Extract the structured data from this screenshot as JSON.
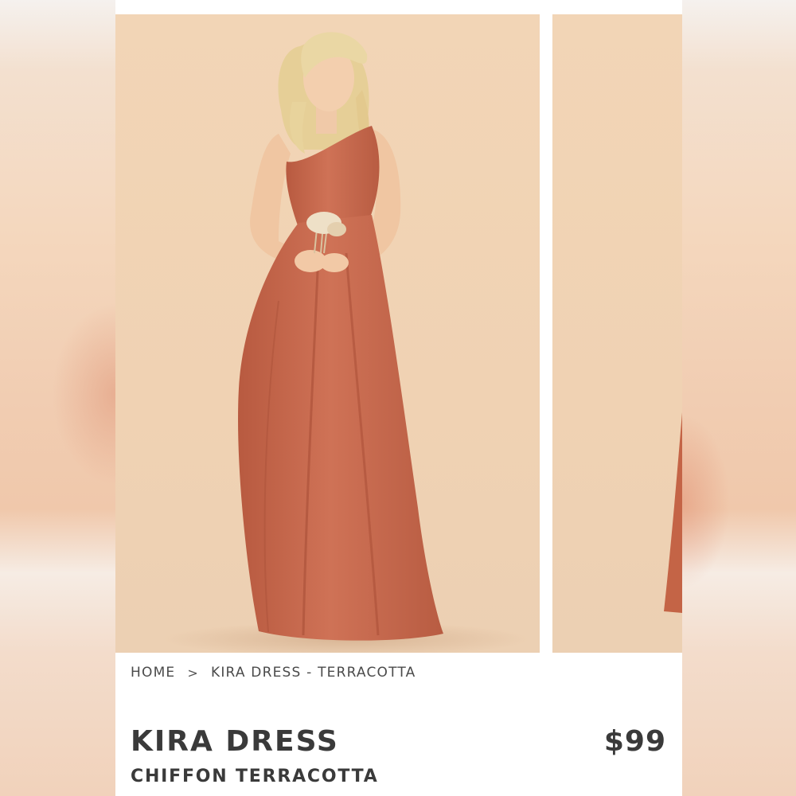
{
  "breadcrumb": {
    "home": "HOME",
    "separator": ">",
    "current": "KIRA DRESS - TERRACOTTA"
  },
  "product": {
    "title": "KIRA DRESS",
    "subtitle": "CHIFFON TERRACOTTA",
    "price": "$99"
  },
  "gallery": {
    "main_image": "model-in-terracotta-one-shoulder-dress",
    "next_image": "partial-dress-preview",
    "background_color": "#f2d5b6",
    "dress_color": "#c8694e"
  }
}
